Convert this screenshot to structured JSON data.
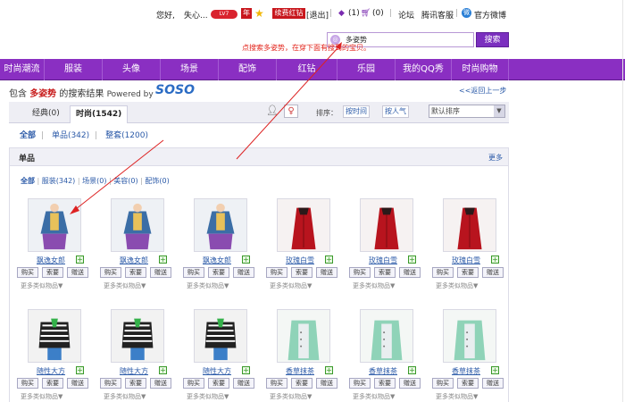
{
  "topbar": {
    "greeting": "您好,",
    "username": "失心...",
    "level_badge": "LV7",
    "vip_badge": "年",
    "red_diamond": "续费红钻",
    "logout": "[退出]",
    "bell_count": "(1)",
    "cart_count": "(0)",
    "forum": "论坛",
    "service": "腾讯客服",
    "weibo": "官方微博"
  },
  "annotation": "点搜索多姿势，在穿下面有搜到的宝贝。",
  "search": {
    "query": "多姿势",
    "button": "搜索"
  },
  "nav": {
    "items": [
      "时尚潮流",
      "服装",
      "头像",
      "场景",
      "配饰",
      "红钻",
      "乐园",
      "我的QQ秀",
      "时尚购物"
    ]
  },
  "results": {
    "prefix": "包含",
    "keyword": "多姿势",
    "suffix": "的搜索结果",
    "powered": "Powered by",
    "soso": "SOSO",
    "back": "<<返回上一步"
  },
  "tabs": {
    "classic": "经典(0)",
    "fashion": "时尚(1542)"
  },
  "sort": {
    "label": "排序：",
    "by_time": "按时间",
    "by_popularity": "按人气",
    "select_value": "默认排序"
  },
  "filter": {
    "all": "全部",
    "single": "单品(342)",
    "outfit": "整套(1200)"
  },
  "section": {
    "title": "单品",
    "more": "更多",
    "subfilter": [
      "全部",
      "服装(342)",
      "场景(0)",
      "美容(0)",
      "配饰(0)"
    ]
  },
  "product_buttons": {
    "buy": "购买",
    "ask": "索要",
    "gift": "赠送",
    "similar": "更多类似物品▼"
  },
  "products": [
    {
      "name": "飘逸女郎",
      "style": "denim"
    },
    {
      "name": "飘逸女郎",
      "style": "denim"
    },
    {
      "name": "飘逸女郎",
      "style": "denim"
    },
    {
      "name": "玫瑰白雪",
      "style": "redcoat"
    },
    {
      "name": "玫瑰白雪",
      "style": "redcoat"
    },
    {
      "name": "玫瑰白雪",
      "style": "redcoat"
    },
    {
      "name": "随性大方",
      "style": "stripe"
    },
    {
      "name": "随性大方",
      "style": "stripe"
    },
    {
      "name": "随性大方",
      "style": "stripe"
    },
    {
      "name": "香草抹茶",
      "style": "mint"
    },
    {
      "name": "香草抹茶",
      "style": "mint"
    },
    {
      "name": "香草抹茶",
      "style": "mint"
    }
  ],
  "colors": {
    "nav_purple": "#8a2fc2",
    "link_blue": "#2b5aa8",
    "annotation_red": "#e2231a",
    "keyword_red": "#c81d1d"
  }
}
